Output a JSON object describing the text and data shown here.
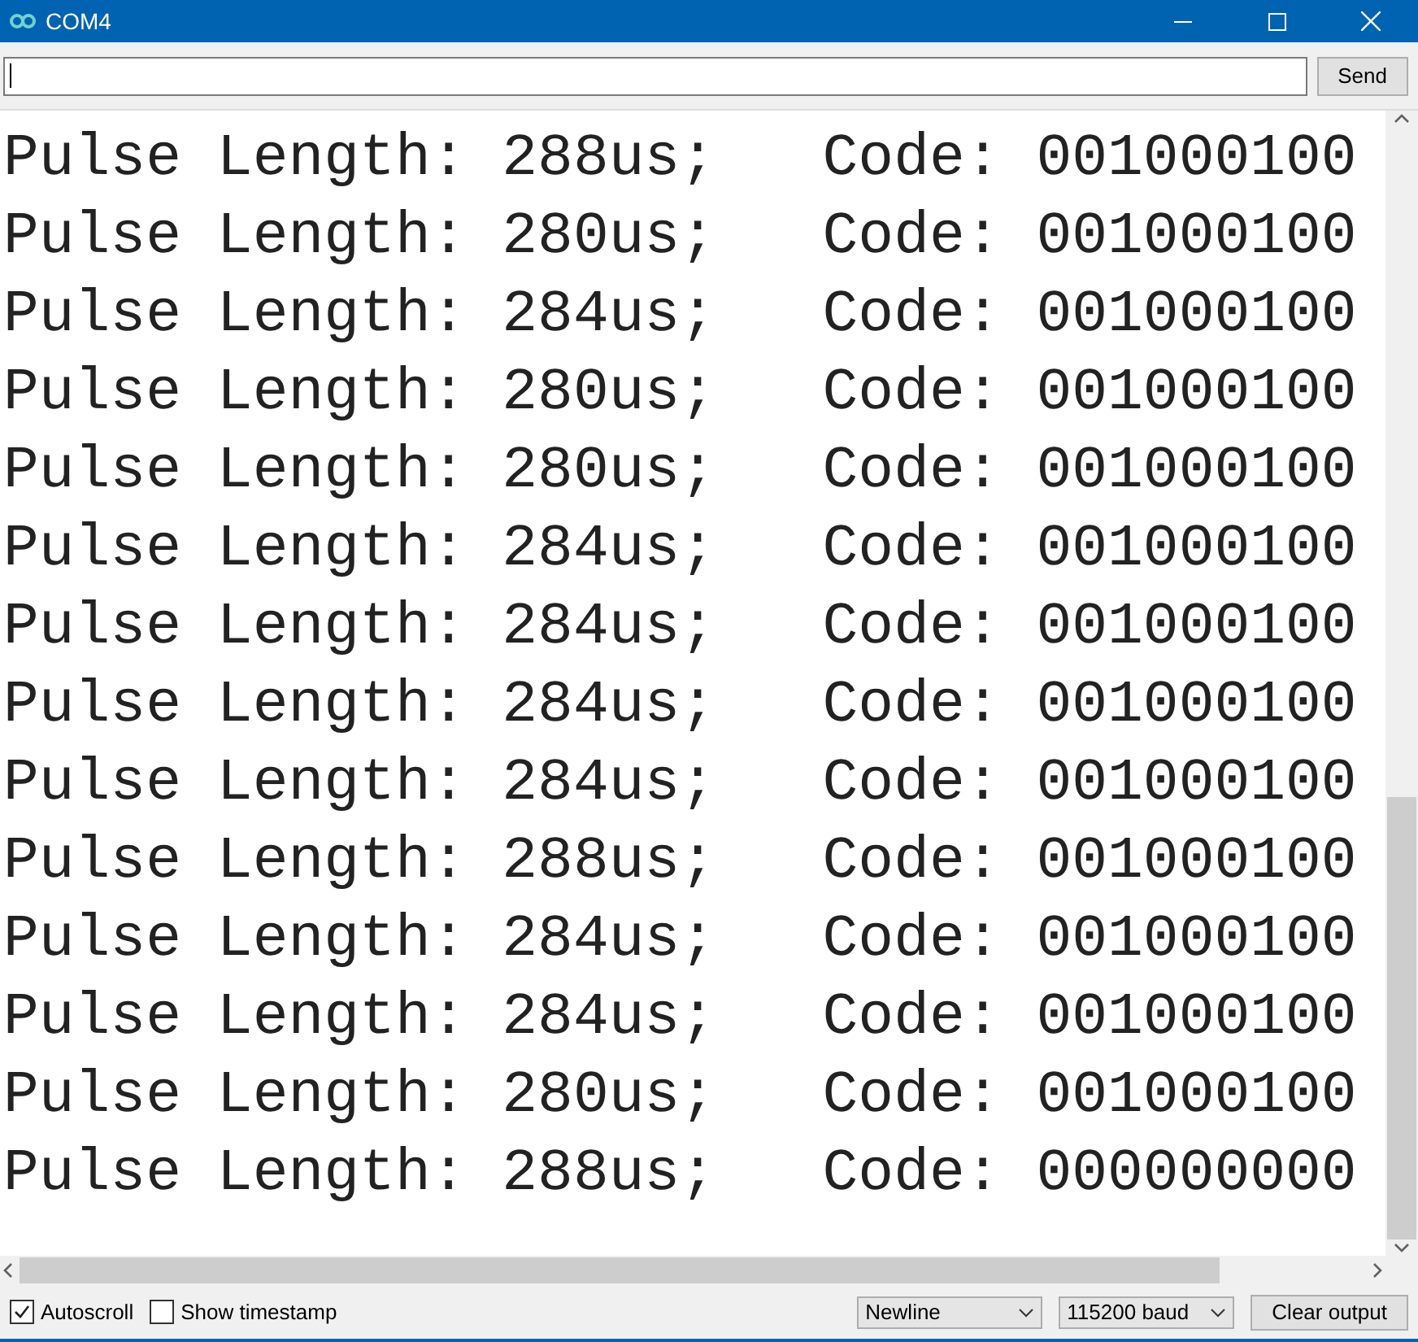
{
  "window": {
    "title": "COM4"
  },
  "input": {
    "send_label": "Send"
  },
  "output_lines": [
    "Pulse Length: 288us;   Code: 001000100",
    "Pulse Length: 280us;   Code: 001000100",
    "Pulse Length: 284us;   Code: 001000100",
    "Pulse Length: 280us;   Code: 001000100",
    "Pulse Length: 280us;   Code: 001000100",
    "Pulse Length: 284us;   Code: 001000100",
    "Pulse Length: 284us;   Code: 001000100",
    "Pulse Length: 284us;   Code: 001000100",
    "Pulse Length: 284us;   Code: 001000100",
    "Pulse Length: 288us;   Code: 001000100",
    "Pulse Length: 284us;   Code: 001000100",
    "Pulse Length: 284us;   Code: 001000100",
    "Pulse Length: 280us;   Code: 001000100",
    "Pulse Length: 288us;   Code: 000000000"
  ],
  "status_bar": {
    "checkboxes": [
      {
        "label": "Autoscroll",
        "checked": true
      },
      {
        "label": "Show timestamp",
        "checked": false
      }
    ],
    "line_ending": "Newline",
    "baud_rate": "115200 baud",
    "clear_label": "Clear output"
  }
}
